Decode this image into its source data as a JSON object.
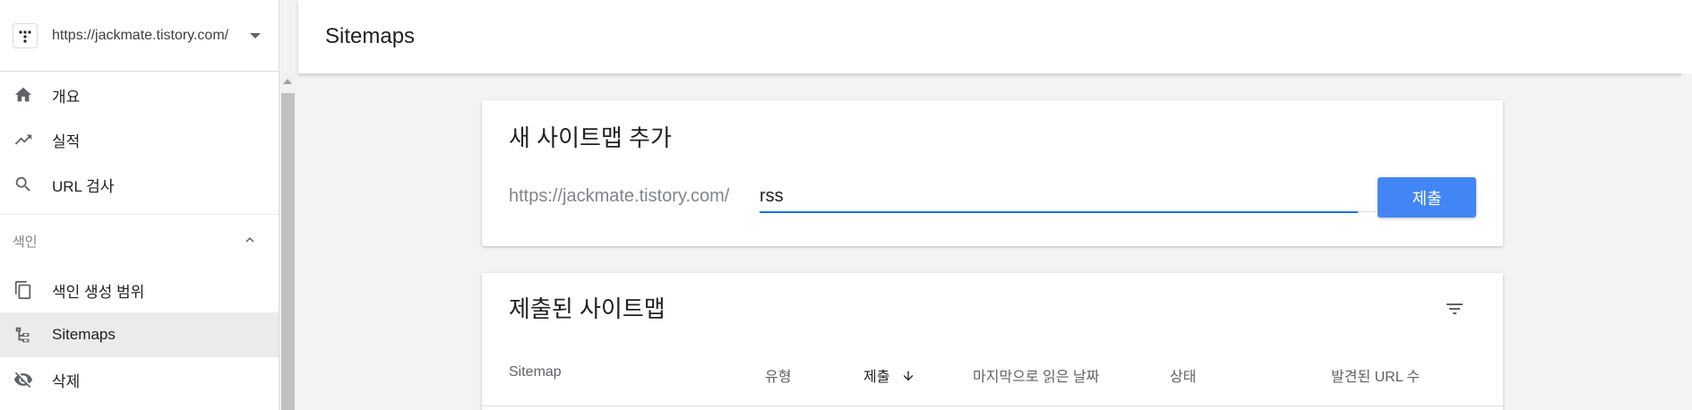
{
  "property": {
    "url": "https://jackmate.tistory.com/"
  },
  "sidebar": {
    "items_top": [
      {
        "label": "개요",
        "icon": "home-icon"
      },
      {
        "label": "실적",
        "icon": "trending-up-icon"
      },
      {
        "label": "URL 검사",
        "icon": "search-icon"
      }
    ],
    "section_label": "색인",
    "items_index": [
      {
        "label": "색인 생성 범위",
        "icon": "copy-icon"
      },
      {
        "label": "Sitemaps",
        "icon": "sitemap-icon",
        "active": true
      },
      {
        "label": "삭제",
        "icon": "visibility-off-icon"
      }
    ]
  },
  "header": {
    "title": "Sitemaps"
  },
  "add_card": {
    "title": "새 사이트맵 추가",
    "url_prefix": "https://jackmate.tistory.com/",
    "input_value": "rss",
    "submit_label": "제출"
  },
  "submitted_card": {
    "title": "제출된 사이트맵",
    "columns": [
      "Sitemap",
      "유형",
      "제출",
      "마지막으로 읽은 날짜",
      "상태",
      "발견된 URL 수"
    ],
    "sorted_column": "제출",
    "sort_direction": "down"
  },
  "colors": {
    "accent": "#1a73e8",
    "button": "#4285f4",
    "active_bg": "#ebebeb"
  }
}
